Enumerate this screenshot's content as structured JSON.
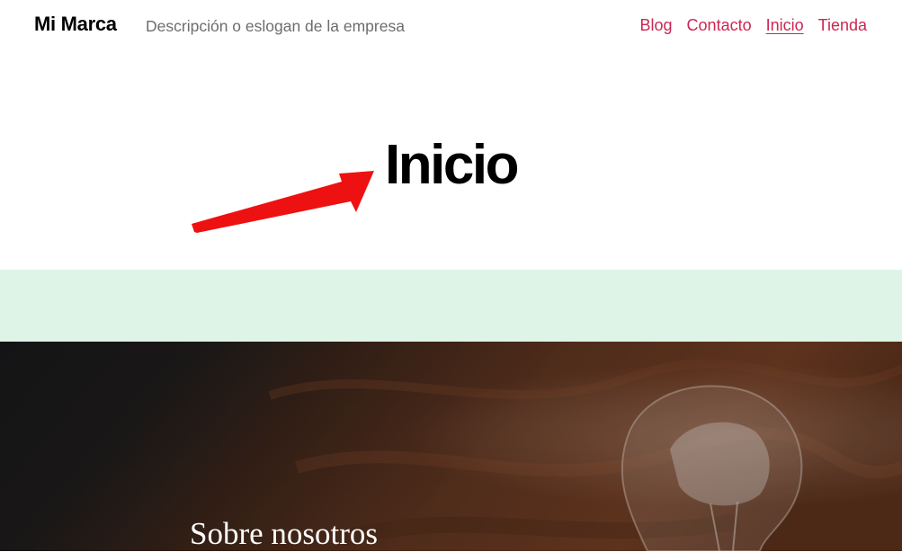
{
  "header": {
    "brand": "Mi Marca",
    "tagline": "Descripción o eslogan de la empresa",
    "nav": [
      {
        "label": "Blog"
      },
      {
        "label": "Contacto"
      },
      {
        "label": "Inicio",
        "current": true
      },
      {
        "label": "Tienda"
      }
    ]
  },
  "main": {
    "page_title": "Inicio",
    "annotation": "arrow-icon"
  },
  "hero": {
    "heading": "Sobre nosotros",
    "image": "lightbulb-on-wood"
  },
  "colors": {
    "accent": "#cd2653",
    "band": "#def4e7",
    "hero_dark": "#1b1b1d",
    "arrow": "#ee1111"
  }
}
